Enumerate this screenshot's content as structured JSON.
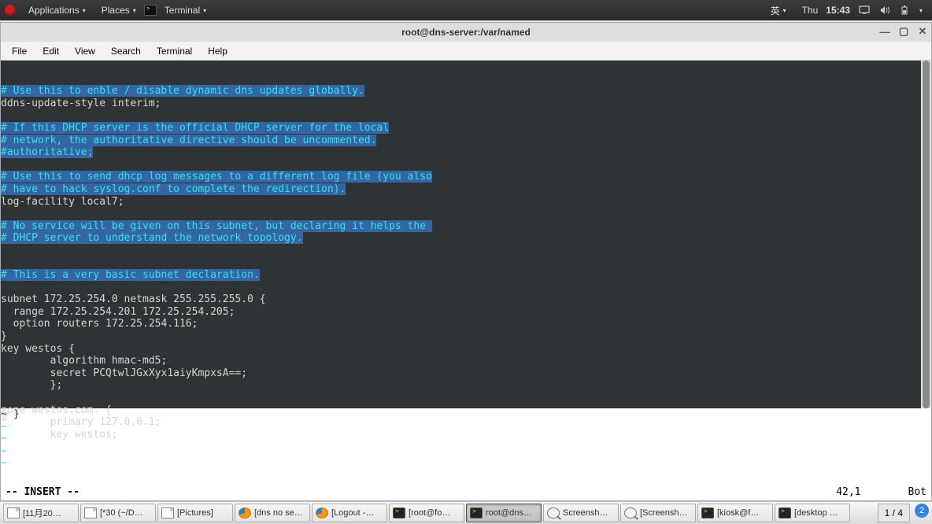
{
  "topbar": {
    "applications": "Applications",
    "places": "Places",
    "terminal": "Terminal",
    "ime": "英",
    "day": "Thu",
    "time": "15:43"
  },
  "window": {
    "title": "root@dns-server:/var/named"
  },
  "menubar": {
    "file": "File",
    "edit": "Edit",
    "view": "View",
    "search": "Search",
    "terminal": "Terminal",
    "help": "Help"
  },
  "editor": {
    "lines": [
      {
        "t": "# Use this to enble / disable dynamic dns updates globally.",
        "cls": "comment-sel"
      },
      {
        "t": "ddns-update-style interim;",
        "cls": ""
      },
      {
        "t": "",
        "cls": ""
      },
      {
        "t": "# If this DHCP server is the official DHCP server for the local",
        "cls": "comment-sel"
      },
      {
        "t": "# network, the authoritative directive should be uncommented.",
        "cls": "comment-sel"
      },
      {
        "t": "#authoritative;",
        "cls": "comment-sel"
      },
      {
        "t": "",
        "cls": ""
      },
      {
        "t": "# Use this to send dhcp log messages to a different log file (you also",
        "cls": "comment-sel"
      },
      {
        "t": "# have to hack syslog.conf to complete the redirection).",
        "cls": "comment-sel"
      },
      {
        "t": "log-facility local7;",
        "cls": ""
      },
      {
        "t": "",
        "cls": ""
      },
      {
        "t": "# No service will be given on this subnet, but declaring it helps the ",
        "cls": "comment-sel"
      },
      {
        "t": "# DHCP server to understand the network topology.",
        "cls": "comment-sel"
      },
      {
        "t": "",
        "cls": ""
      },
      {
        "t": "",
        "cls": ""
      },
      {
        "t": "# This is a very basic subnet declaration.",
        "cls": "comment-sel"
      },
      {
        "t": "",
        "cls": ""
      },
      {
        "t": "subnet 172.25.254.0 netmask 255.255.255.0 {",
        "cls": ""
      },
      {
        "t": "  range 172.25.254.201 172.25.254.205;",
        "cls": ""
      },
      {
        "t": "  option routers 172.25.254.116;",
        "cls": ""
      },
      {
        "t": "}",
        "cls": ""
      },
      {
        "t": "key westos {",
        "cls": ""
      },
      {
        "t": "        algorithm hmac-md5;",
        "cls": ""
      },
      {
        "t": "        secret PCQtwlJGxXyx1aiyKmpxsA==;",
        "cls": ""
      },
      {
        "t": "        };",
        "cls": ""
      },
      {
        "t": "",
        "cls": ""
      },
      {
        "t": "zone westos.com. {",
        "cls": ""
      },
      {
        "t": "        primary 127.0.0.1;",
        "cls": ""
      },
      {
        "t": "        key westos;",
        "cls": ""
      }
    ],
    "line30prefix": "~",
    "line30rest": "        }",
    "tildes": [
      "~",
      "~",
      "~",
      "~"
    ],
    "mode": "-- INSERT --",
    "pos": "42,1",
    "scroll": "Bot"
  },
  "taskbar": {
    "items": [
      {
        "icon": "file",
        "label": "[11月20…"
      },
      {
        "icon": "file",
        "label": "[*30 (~/D…"
      },
      {
        "icon": "file",
        "label": "[Pictures]"
      },
      {
        "icon": "firefox",
        "label": "[dns no se…"
      },
      {
        "icon": "firefox",
        "label": "[Logout -…"
      },
      {
        "icon": "term",
        "label": "[root@fo…"
      },
      {
        "icon": "term",
        "label": "root@dns…",
        "active": true
      },
      {
        "icon": "mag",
        "label": "Screensh…"
      },
      {
        "icon": "mag",
        "label": "[Screensh…"
      },
      {
        "icon": "term",
        "label": "[kiosk@f…"
      },
      {
        "icon": "term",
        "label": "[desktop …"
      }
    ],
    "workspace": "1 / 4",
    "badge": "2"
  }
}
